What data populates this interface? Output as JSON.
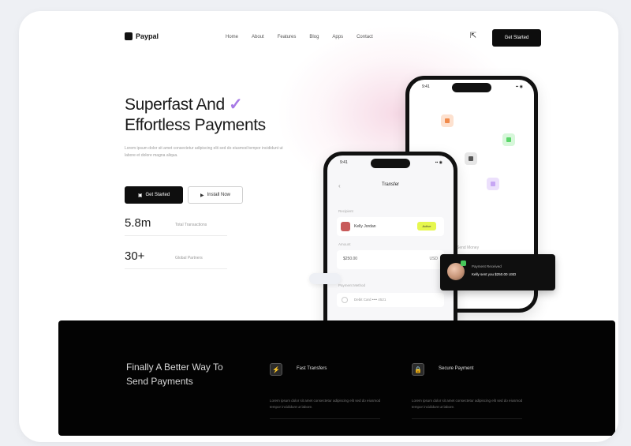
{
  "nav": {
    "logo_text": "Paypal",
    "links": [
      "Home",
      "About",
      "Features",
      "Blog",
      "Apps",
      "Contact"
    ],
    "cta_label": "Get Started"
  },
  "hero": {
    "title_line1": "Superfast And",
    "title_line2": "Effortless Payments",
    "check_glyph": "✓",
    "description": "Lorem ipsum dolor sit amet consectetur adipiscing elit sed do eiusmod tempor incididunt ut labore et dolore magna aliqua.",
    "primary_button": "Get Started",
    "secondary_button": "Install Now",
    "stats": [
      {
        "value": "5.8m",
        "label": "Total Transactions"
      },
      {
        "value": "30+",
        "label": "Global Partners"
      }
    ]
  },
  "phone_back": {
    "time": "9:41",
    "signal": "▪▪ ◉",
    "foot": "Send Money"
  },
  "phone_front": {
    "time": "9:41",
    "signal": "▪▪ ◉",
    "back_glyph": "‹",
    "screen_title": "Transfer",
    "recipient_section": "Recipient",
    "recipient_name": "Kelly Jordan",
    "recipient_chip": "Active",
    "amount_section": "Amount",
    "amount_value": "$250.00",
    "amount_currency": "USD",
    "bottom_section": "Payment Method",
    "bottom_text": "Debit Card •••• 4521"
  },
  "toast": {
    "line1": "Payment Received",
    "line2": "Kelly sent you $250.00 USD"
  },
  "dark_section": {
    "title": "Finally A Better Way To Send Payments",
    "features": [
      {
        "icon": "⚡",
        "title": "Fast Transfers",
        "desc": "Lorem ipsum dolor sit amet consectetur adipiscing elit sed do eiusmod tempor incididunt ut labore."
      },
      {
        "icon": "🔒",
        "title": "Secure Payment",
        "desc": "Lorem ipsum dolor sit amet consectetur adipiscing elit sed do eiusmod tempor incididunt ut labore."
      }
    ]
  },
  "colors": {
    "accent_purple": "#a77ae6",
    "accent_yellow": "#e6f74f",
    "tile_orange": "#f08a4b",
    "tile_green": "#5bd66a",
    "tile_purple": "#c7a6f4",
    "dark_band": "#030303"
  }
}
